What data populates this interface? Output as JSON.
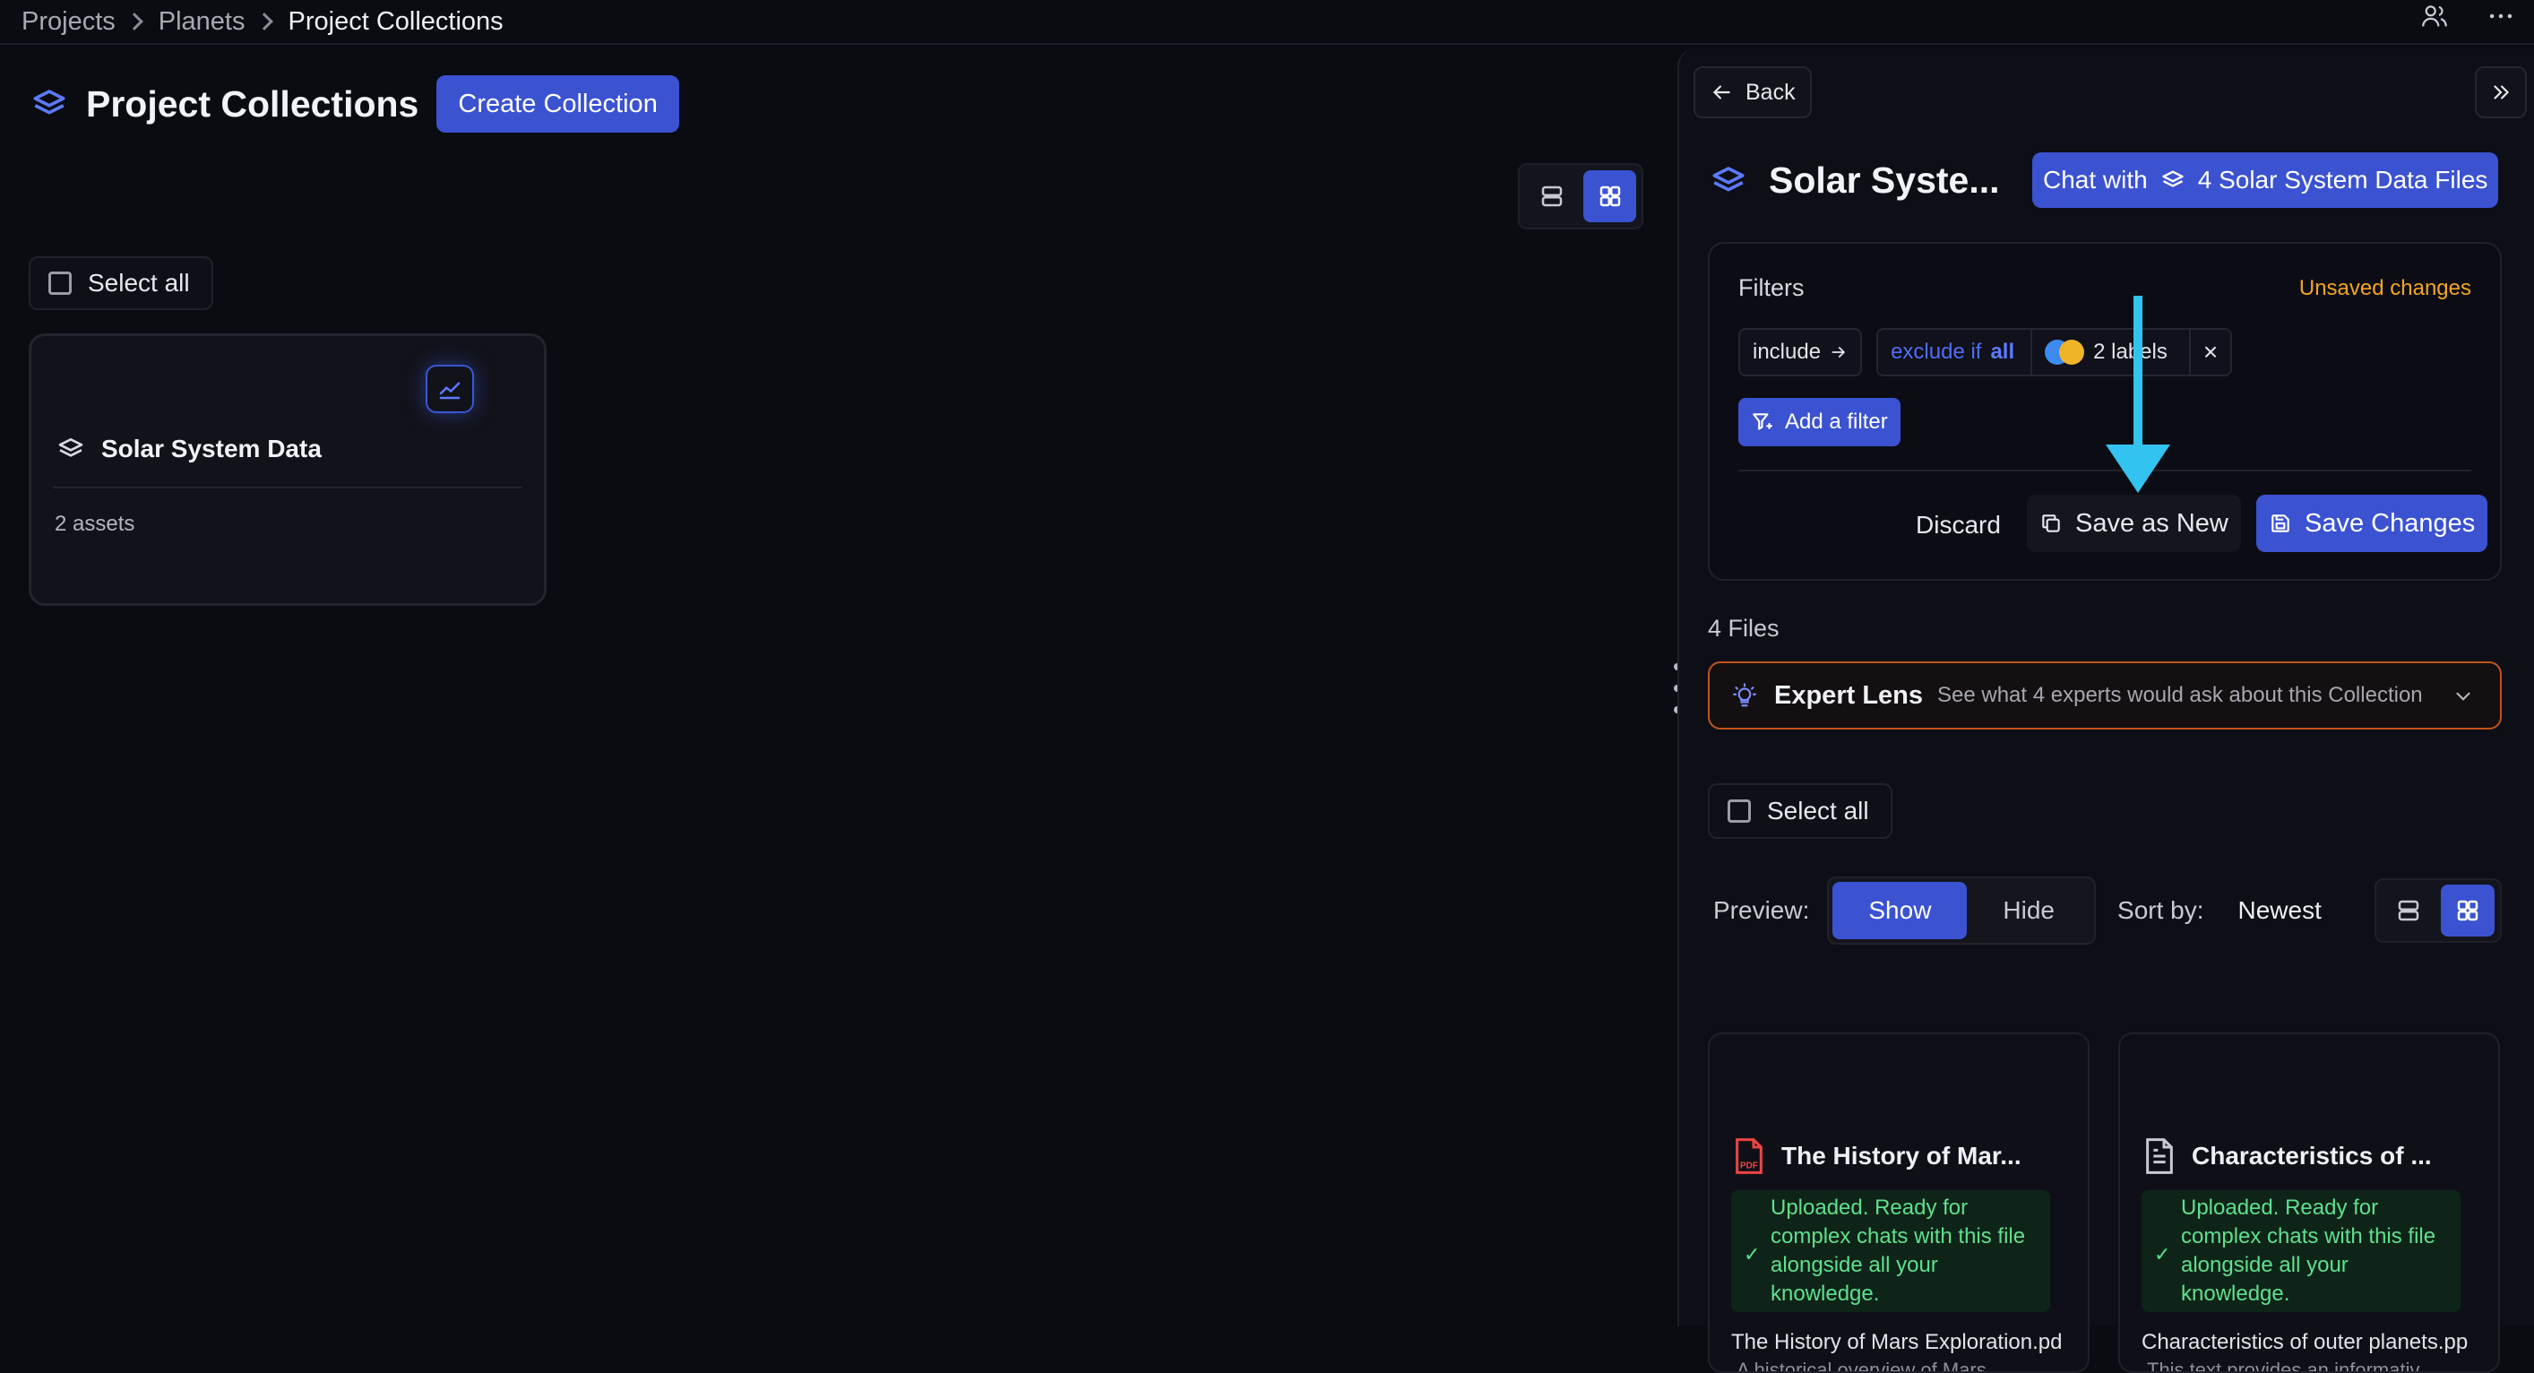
{
  "breadcrumb": [
    "Projects",
    "Planets",
    "Project Collections"
  ],
  "header": {
    "title": "Project Collections",
    "create_label": "Create Collection"
  },
  "left": {
    "select_all": "Select all",
    "collection": {
      "name": "Solar System Data",
      "assets": "2 assets"
    }
  },
  "panel": {
    "back": "Back",
    "title": "Solar Syste...",
    "chat_prefix": "Chat with",
    "chat_target": "4 Solar System Data Files",
    "filters": {
      "label": "Filters",
      "unsaved": "Unsaved changes",
      "include": "include",
      "exclude_prefix": "exclude if",
      "exclude_bold": "all",
      "labels": "2 labels",
      "remove": "×",
      "add": "Add a filter",
      "discard": "Discard",
      "save_new": "Save as New",
      "save_changes": "Save Changes"
    },
    "files_count": "4 Files",
    "expert": {
      "title": "Expert Lens",
      "subtitle": "See what 4 experts would ask about this Collection"
    },
    "select_all": "Select all",
    "preview": {
      "label": "Preview:",
      "show": "Show",
      "hide": "Hide"
    },
    "sort": {
      "label": "Sort by:",
      "value": "Newest"
    },
    "files": [
      {
        "title": "The History of Mar...",
        "status": "Uploaded. Ready for complex chats with this file alongside all your knowledge.",
        "filename": "The History of Mars Exploration.pd",
        "desc": "A historical overview of Mars"
      },
      {
        "title": "Characteristics of ...",
        "status": "Uploaded. Ready for complex chats with this file alongside all your knowledge.",
        "filename": "Characteristics of outer planets.pp",
        "desc": "This text provides an informativ"
      }
    ]
  },
  "colors": {
    "accent": "#3b52d1",
    "warning": "#f5a524",
    "success": "#5fe08d",
    "annotation_arrow": "#33c3f0"
  }
}
